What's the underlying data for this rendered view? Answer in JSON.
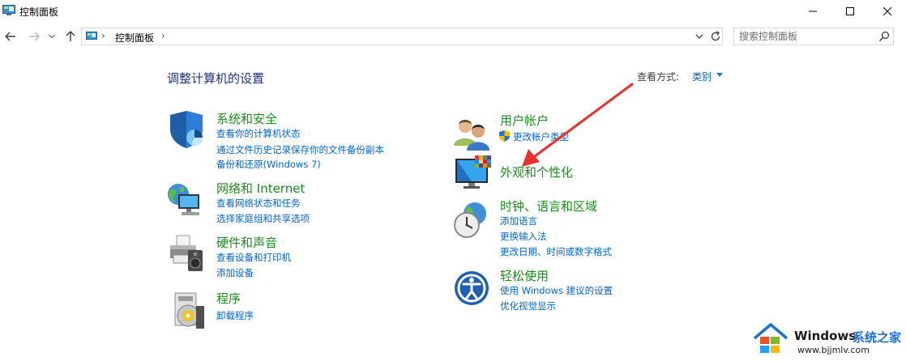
{
  "window": {
    "title": "控制面板",
    "controls": [
      "minimize-icon",
      "maximize-icon",
      "close-icon"
    ]
  },
  "addressbar": {
    "crumb": "控制面板",
    "separator": "›",
    "nav_icons": [
      "back-arrow-icon",
      "forward-arrow-icon",
      "recent-dropdown-icon",
      "up-arrow-icon"
    ]
  },
  "search": {
    "placeholder": "搜索控制面板"
  },
  "main": {
    "heading": "调整计算机的设置",
    "view_by_label": "查看方式:",
    "view_by_value": "类别"
  },
  "categories_left": [
    {
      "title": "系统和安全",
      "icon": "shield-icon",
      "links": [
        "查看你的计算机状态",
        "通过文件历史记录保存你的文件备份副本",
        "备份和还原(Windows 7)"
      ]
    },
    {
      "title": "网络和 Internet",
      "icon": "network-globe-icon",
      "links": [
        "查看网络状态和任务",
        "选择家庭组和共享选项"
      ]
    },
    {
      "title": "硬件和声音",
      "icon": "printer-speaker-icon",
      "links": [
        "查看设备和打印机",
        "添加设备"
      ]
    },
    {
      "title": "程序",
      "icon": "programs-disc-icon",
      "links": [
        "卸载程序"
      ]
    }
  ],
  "categories_right": [
    {
      "title": "用户帐户",
      "icon": "users-icon",
      "links": [
        "更改帐户类型"
      ]
    },
    {
      "title": "外观和个性化",
      "icon": "monitor-palette-icon",
      "links": []
    },
    {
      "title": "时钟、语言和区域",
      "icon": "clock-globe-icon",
      "links": [
        "添加语言",
        "更换输入法",
        "更改日期、时间或数字格式"
      ]
    },
    {
      "title": "轻松使用",
      "icon": "ease-of-access-icon",
      "links": [
        "使用 Windows 建议的设置",
        "优化视觉显示"
      ]
    }
  ],
  "annotation": {
    "color": "#e8312f"
  },
  "watermark": {
    "brand": "Windows",
    "site": "系统之家",
    "url": "www.bjjmlv.com"
  },
  "colors": {
    "category_title": "#1c8c1c",
    "link": "#0066cc",
    "heading": "#1e3287"
  }
}
